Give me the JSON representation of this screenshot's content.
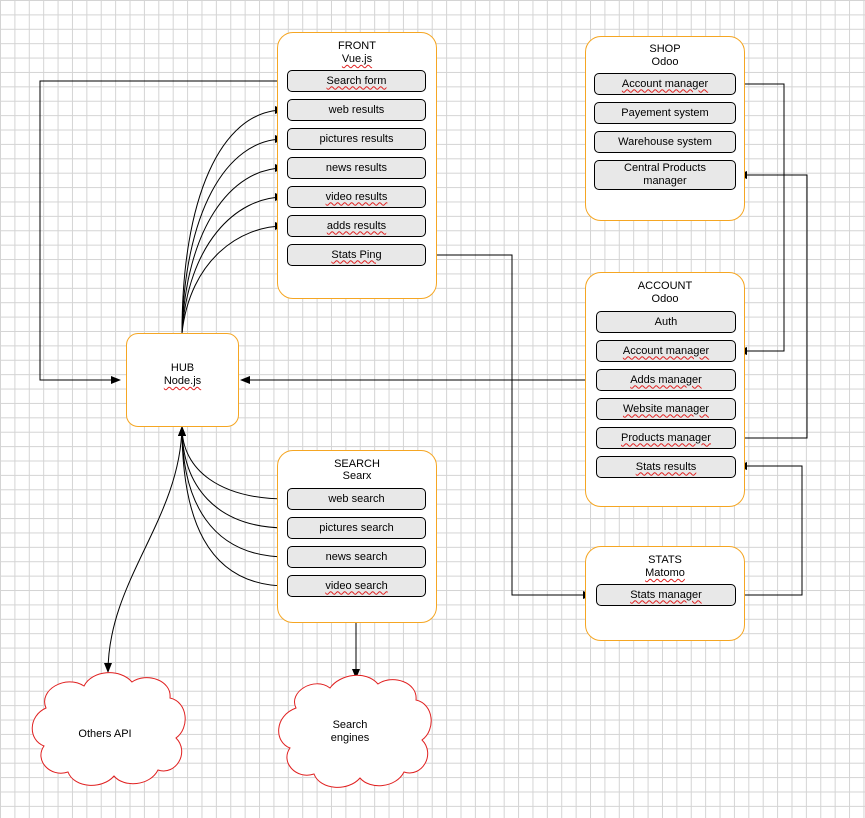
{
  "front": {
    "title": "FRONT",
    "subtitle": "Vue.js",
    "items": [
      "Search form",
      "web results",
      "pictures results",
      "news results",
      "video results",
      "adds results",
      "Stats Ping"
    ]
  },
  "shop": {
    "title": "SHOP",
    "subtitle": "Odoo",
    "items": [
      "Account manager",
      "Payement system",
      "Warehouse system",
      "Central Products manager"
    ]
  },
  "account": {
    "title": "ACCOUNT",
    "subtitle": "Odoo",
    "items": [
      "Auth",
      "Account manager",
      "Adds manager",
      "Website manager",
      "Products manager",
      "Stats results"
    ]
  },
  "hub": {
    "title": "HUB",
    "subtitle": "Node.js"
  },
  "search": {
    "title": "SEARCH",
    "subtitle": "Searx",
    "items": [
      "web search",
      "pictures search",
      "news search",
      "video search"
    ]
  },
  "stats": {
    "title": "STATS",
    "subtitle": "Matomo",
    "items": [
      "Stats manager"
    ]
  },
  "clouds": {
    "others": "Others API",
    "engines_line1": "Search",
    "engines_line2": "engines"
  },
  "colors": {
    "group_border": "#f5a623",
    "cloud_border": "#e02020",
    "item_fill": "#e8e8e8"
  }
}
